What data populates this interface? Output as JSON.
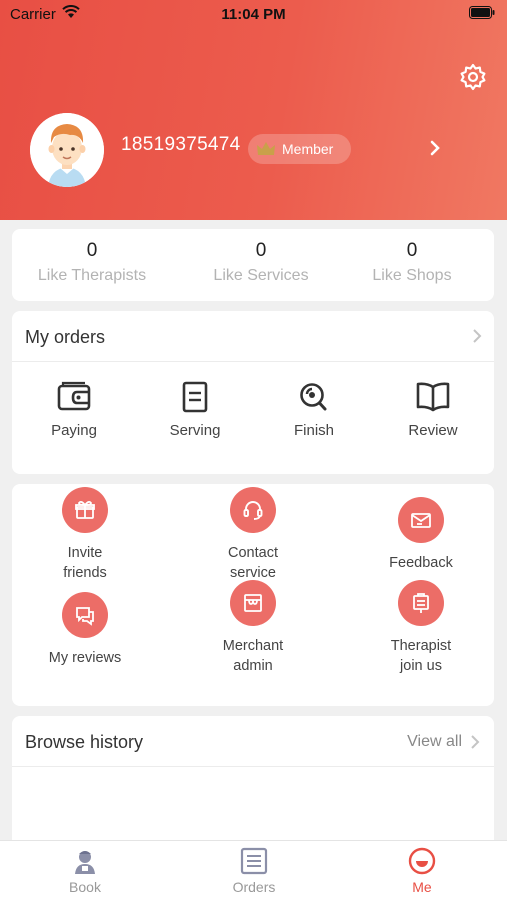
{
  "status_bar": {
    "carrier": "Carrier",
    "time": "11:04 PM"
  },
  "profile": {
    "phone": "18519375474",
    "member_label": "Member"
  },
  "stats": [
    {
      "count": "0",
      "label": "Like Therapists"
    },
    {
      "count": "0",
      "label": "Like Services"
    },
    {
      "count": "0",
      "label": "Like Shops"
    }
  ],
  "orders": {
    "title": "My orders",
    "items": [
      {
        "label": "Paying",
        "icon": "wallet-icon"
      },
      {
        "label": "Serving",
        "icon": "document-icon"
      },
      {
        "label": "Finish",
        "icon": "magnifier-icon"
      },
      {
        "label": "Review",
        "icon": "book-icon"
      }
    ]
  },
  "services": [
    {
      "line1": "Invite",
      "line2": "friends",
      "icon": "gift-icon"
    },
    {
      "line1": "Contact",
      "line2": "service",
      "icon": "headset-icon"
    },
    {
      "line1": "Feedback",
      "line2": "",
      "icon": "mail-icon"
    },
    {
      "line1": "My reviews",
      "line2": "",
      "icon": "chat-icon"
    },
    {
      "line1": "Merchant",
      "line2": "admin",
      "icon": "shop-icon"
    },
    {
      "line1": "Therapist",
      "line2": "join us",
      "icon": "badge-icon"
    }
  ],
  "history": {
    "title": "Browse history",
    "view_all": "View all"
  },
  "tabs": [
    {
      "label": "Book",
      "icon": "therapist-icon",
      "active": false
    },
    {
      "label": "Orders",
      "icon": "list-icon",
      "active": false
    },
    {
      "label": "Me",
      "icon": "me-icon",
      "active": true
    }
  ],
  "colors": {
    "accent": "#e84f44",
    "service_circle": "#ec6d67"
  }
}
